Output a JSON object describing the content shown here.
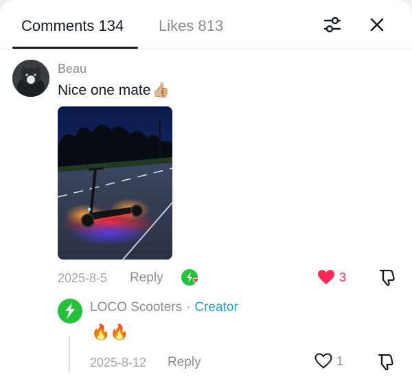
{
  "tabs": {
    "comments_label": "Comments 134",
    "likes_label": "Likes 813"
  },
  "header": {
    "filter_icon": "sliders-icon",
    "close_icon": "close-icon"
  },
  "comment": {
    "username": "Beau",
    "text": "Nice one mate",
    "emoji": "👍🏼",
    "media_subject": "electric scooter with neon underglow on a road at dusk",
    "date": "2025-8-5",
    "reply_label": "Reply",
    "like_count": "3",
    "liked": true
  },
  "reply": {
    "username": "LOCO Scooters",
    "separator": "·",
    "role": "Creator",
    "text": "🔥🔥",
    "date": "2025-8-12",
    "reply_label": "Reply",
    "like_count": "1",
    "liked": false
  },
  "colors": {
    "like_red": "#fe2c55",
    "creator_blue": "#20a0c8",
    "brand_green": "#24c23b"
  }
}
